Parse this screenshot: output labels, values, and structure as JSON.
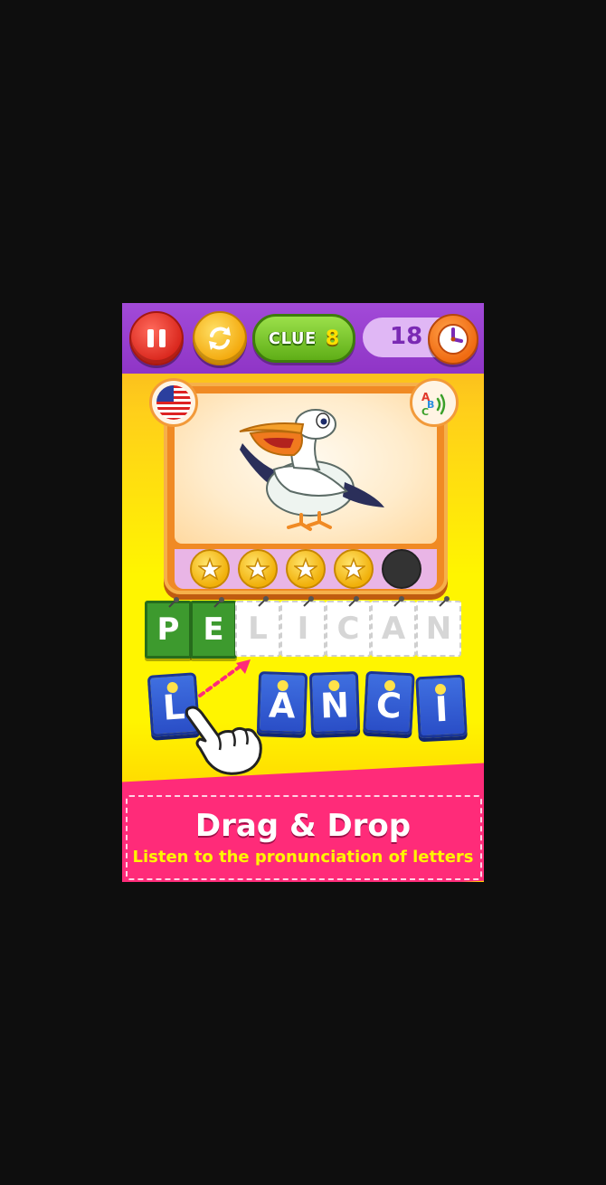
{
  "toolbar": {
    "pause_icon": "pause-icon",
    "refresh_icon": "refresh-icon",
    "clue_label": "CLUE",
    "clue_count": "8",
    "score": "18",
    "timer_icon": "clock-icon"
  },
  "picture": {
    "subject_icon": "pelican-illustration",
    "language_icon": "us-flag-icon",
    "sound_icon": "abc-sound-icon"
  },
  "stars": {
    "earned": 4,
    "total": 5
  },
  "answer_slots": [
    {
      "letter": "P",
      "state": "filled"
    },
    {
      "letter": "E",
      "state": "filled"
    },
    {
      "letter": "L",
      "state": "hint"
    },
    {
      "letter": "I",
      "state": "hint"
    },
    {
      "letter": "C",
      "state": "hint"
    },
    {
      "letter": "A",
      "state": "hint"
    },
    {
      "letter": "N",
      "state": "hint"
    }
  ],
  "letter_tiles": [
    "L",
    "A",
    "N",
    "C",
    "I"
  ],
  "banner": {
    "title": "Drag & Drop",
    "subtitle": "Listen to the pronunciation of letters"
  },
  "colors": {
    "topbar": "#9b42d0",
    "filled_slot": "#3d9a2e",
    "tile": "#2f57d4",
    "banner": "#ff2b79"
  }
}
